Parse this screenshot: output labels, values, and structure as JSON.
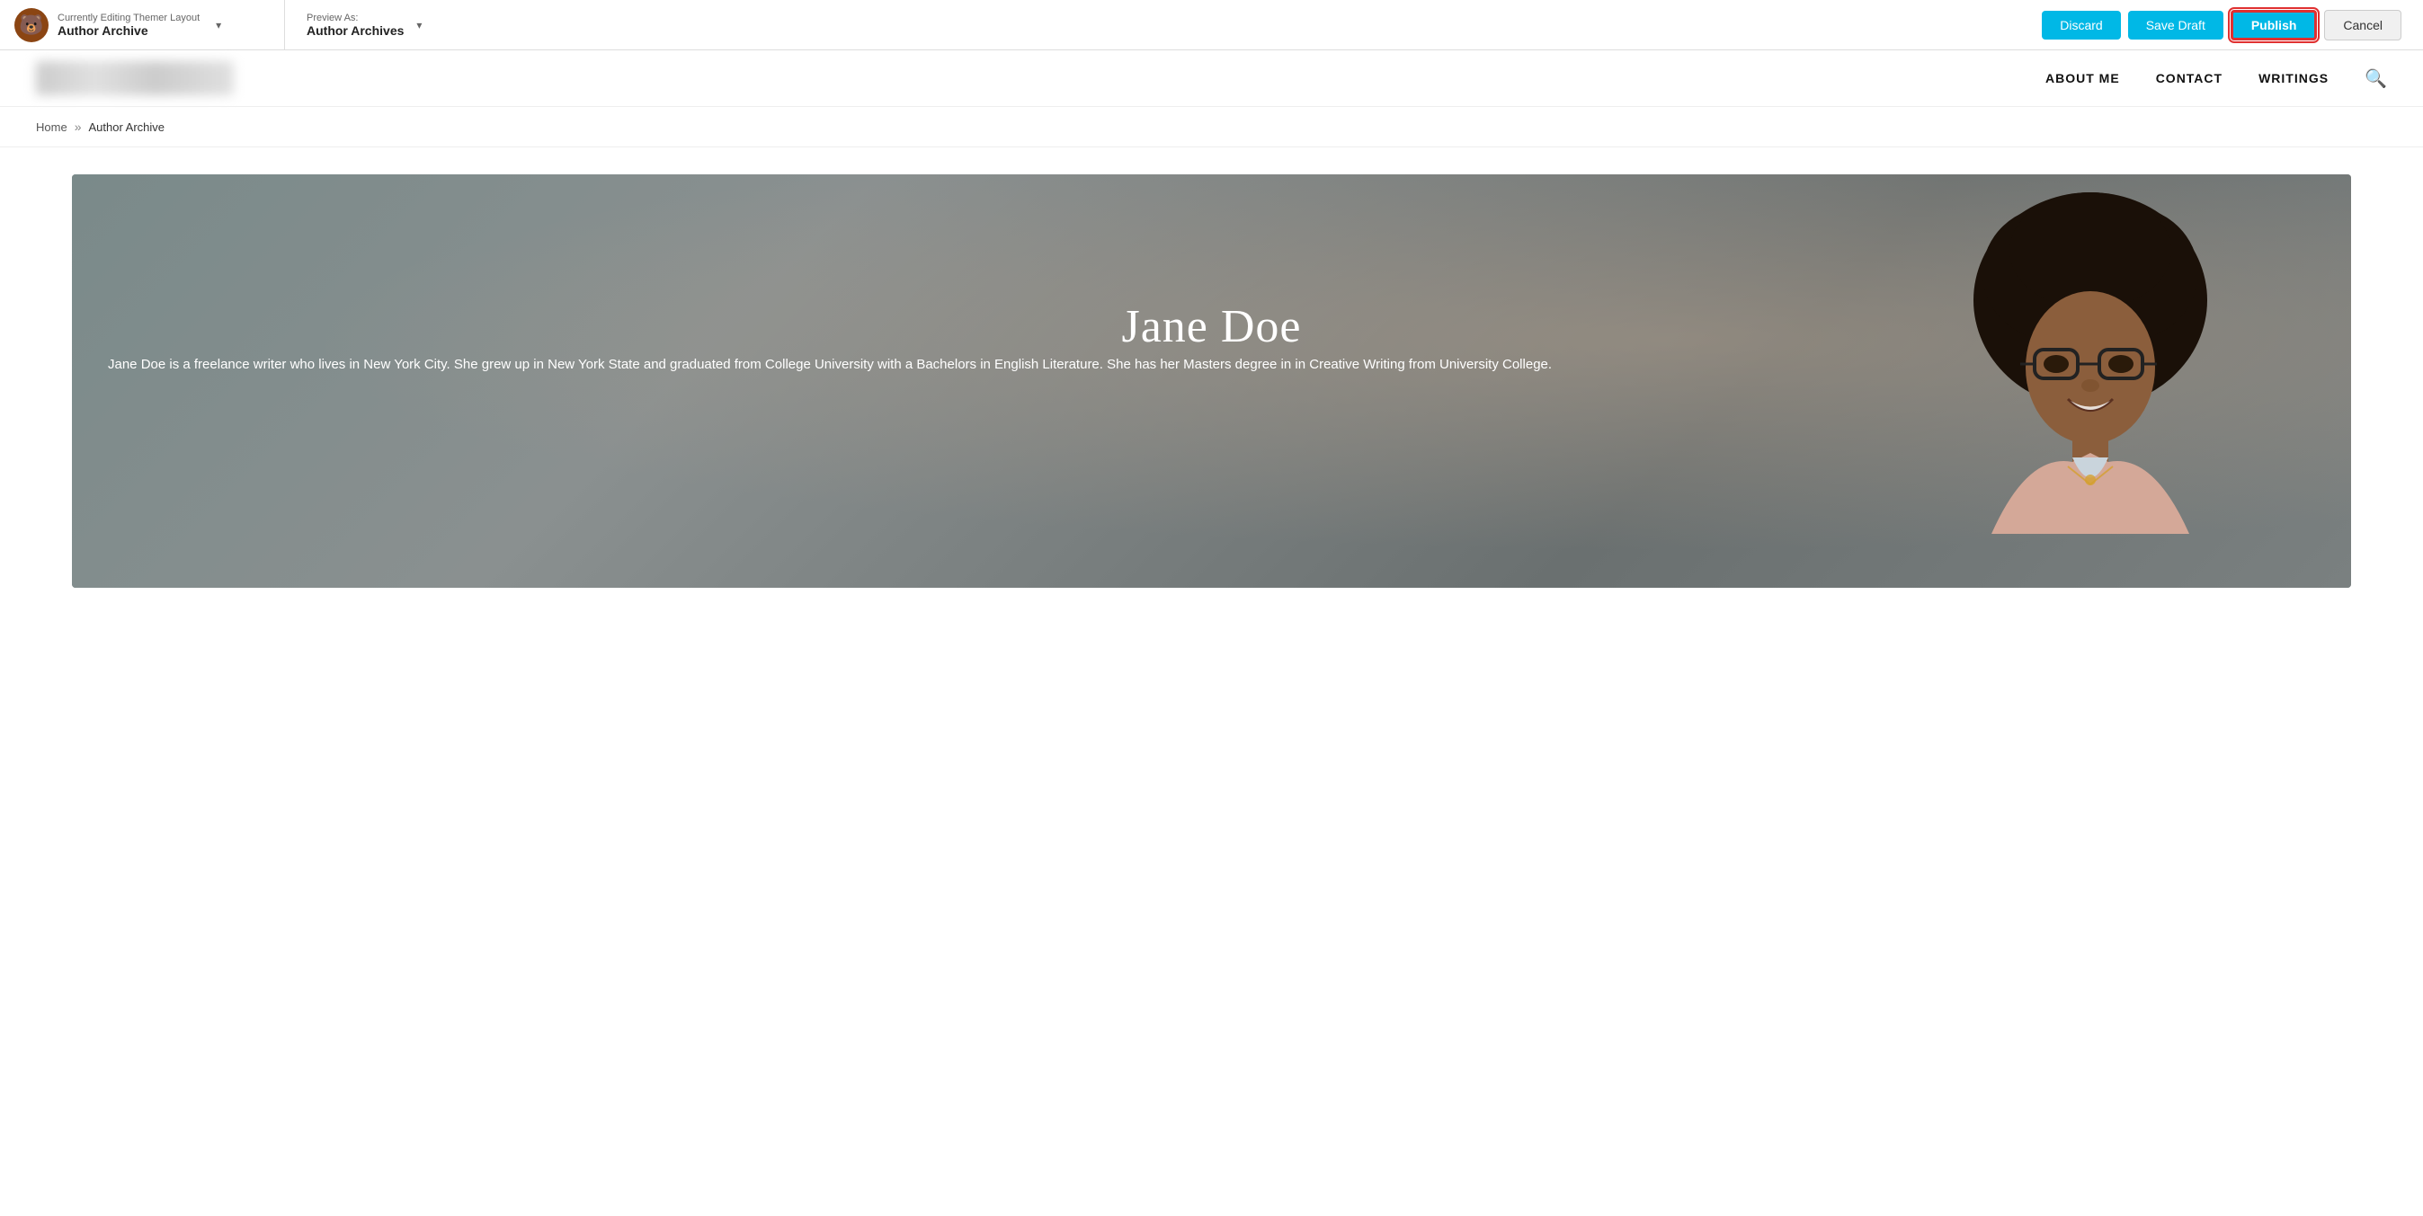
{
  "admin_bar": {
    "logo_icon": "🐻",
    "editing_label": "Currently Editing Themer Layout",
    "editing_title": "Author Archive",
    "preview_label": "Preview As:",
    "preview_value": "Author Archives",
    "discard_label": "Discard",
    "save_draft_label": "Save Draft",
    "publish_label": "Publish",
    "cancel_label": "Cancel"
  },
  "site_nav": {
    "nav_links": [
      {
        "label": "ABOUT ME"
      },
      {
        "label": "CONTACT"
      },
      {
        "label": "WRITINGS"
      }
    ]
  },
  "breadcrumb": {
    "home_label": "Home",
    "separator": "»",
    "current": "Author Archive"
  },
  "hero": {
    "name": "Jane Doe",
    "bio": "Jane Doe is a freelance writer who lives in New York City. She grew up in New York State and graduated from College University with a Bachelors in English Literature. She has her Masters degree in in Creative Writing from University College."
  }
}
